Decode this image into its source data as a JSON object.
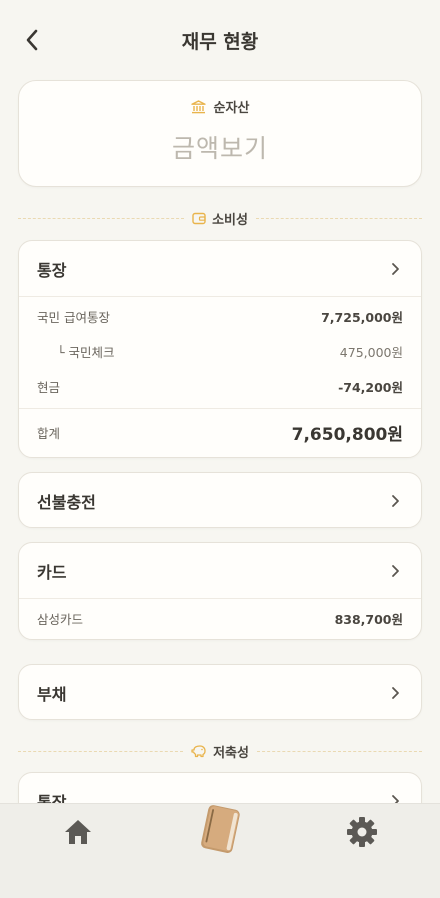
{
  "header": {
    "title": "재무 현황"
  },
  "net_assets": {
    "label": "순자산",
    "value": "금액보기"
  },
  "dividers": {
    "consumption": "소비성",
    "savings": "저축성"
  },
  "bank": {
    "title": "통장",
    "rows": [
      {
        "name": "국민 급여통장",
        "amount": "7,725,000원"
      },
      {
        "name": "└ 국민체크",
        "amount": "475,000원"
      },
      {
        "name": "현금",
        "amount": "-74,200원"
      }
    ],
    "total_label": "합계",
    "total_amount": "7,650,800원"
  },
  "prepaid": {
    "title": "선불충전"
  },
  "card": {
    "title": "카드",
    "rows": [
      {
        "name": "삼성카드",
        "amount": "838,700원"
      }
    ]
  },
  "debt": {
    "title": "부채"
  },
  "savings_bank": {
    "title": "통장"
  },
  "colors": {
    "accent": "#e9b44c",
    "background": "#f7f6f1",
    "tabbar": "#efeee9",
    "book": "#d6ab7e"
  },
  "icons": {
    "back": "chevron-left-icon",
    "bank": "bank-icon",
    "wallet": "wallet-icon",
    "piggy": "piggy-bank-icon",
    "home": "home-icon",
    "book": "ledger-book-icon",
    "settings": "gear-icon"
  }
}
